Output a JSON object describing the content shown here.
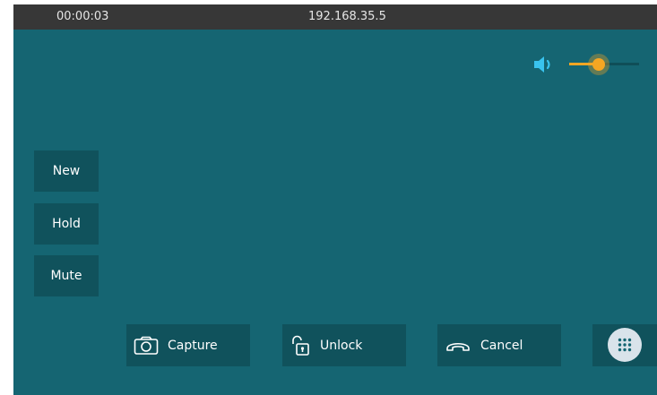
{
  "status_bar": {
    "elapsed": "00:00:03",
    "address": "192.168.35.5"
  },
  "volume": {
    "icon": "speaker-icon",
    "level": 0.42,
    "accent": "#f5a623"
  },
  "side_buttons": {
    "new": "New",
    "hold": "Hold",
    "mute": "Mute"
  },
  "actions": {
    "capture": {
      "label": "Capture",
      "icon": "camera-icon"
    },
    "unlock": {
      "label": "Unlock",
      "icon": "unlock-icon"
    },
    "cancel": {
      "label": "Cancel",
      "icon": "hang-up-icon"
    },
    "keypad": {
      "icon": "dialpad-icon"
    }
  },
  "colors": {
    "background": "#156572",
    "button": "#10525c",
    "status_bar": "#373737"
  }
}
